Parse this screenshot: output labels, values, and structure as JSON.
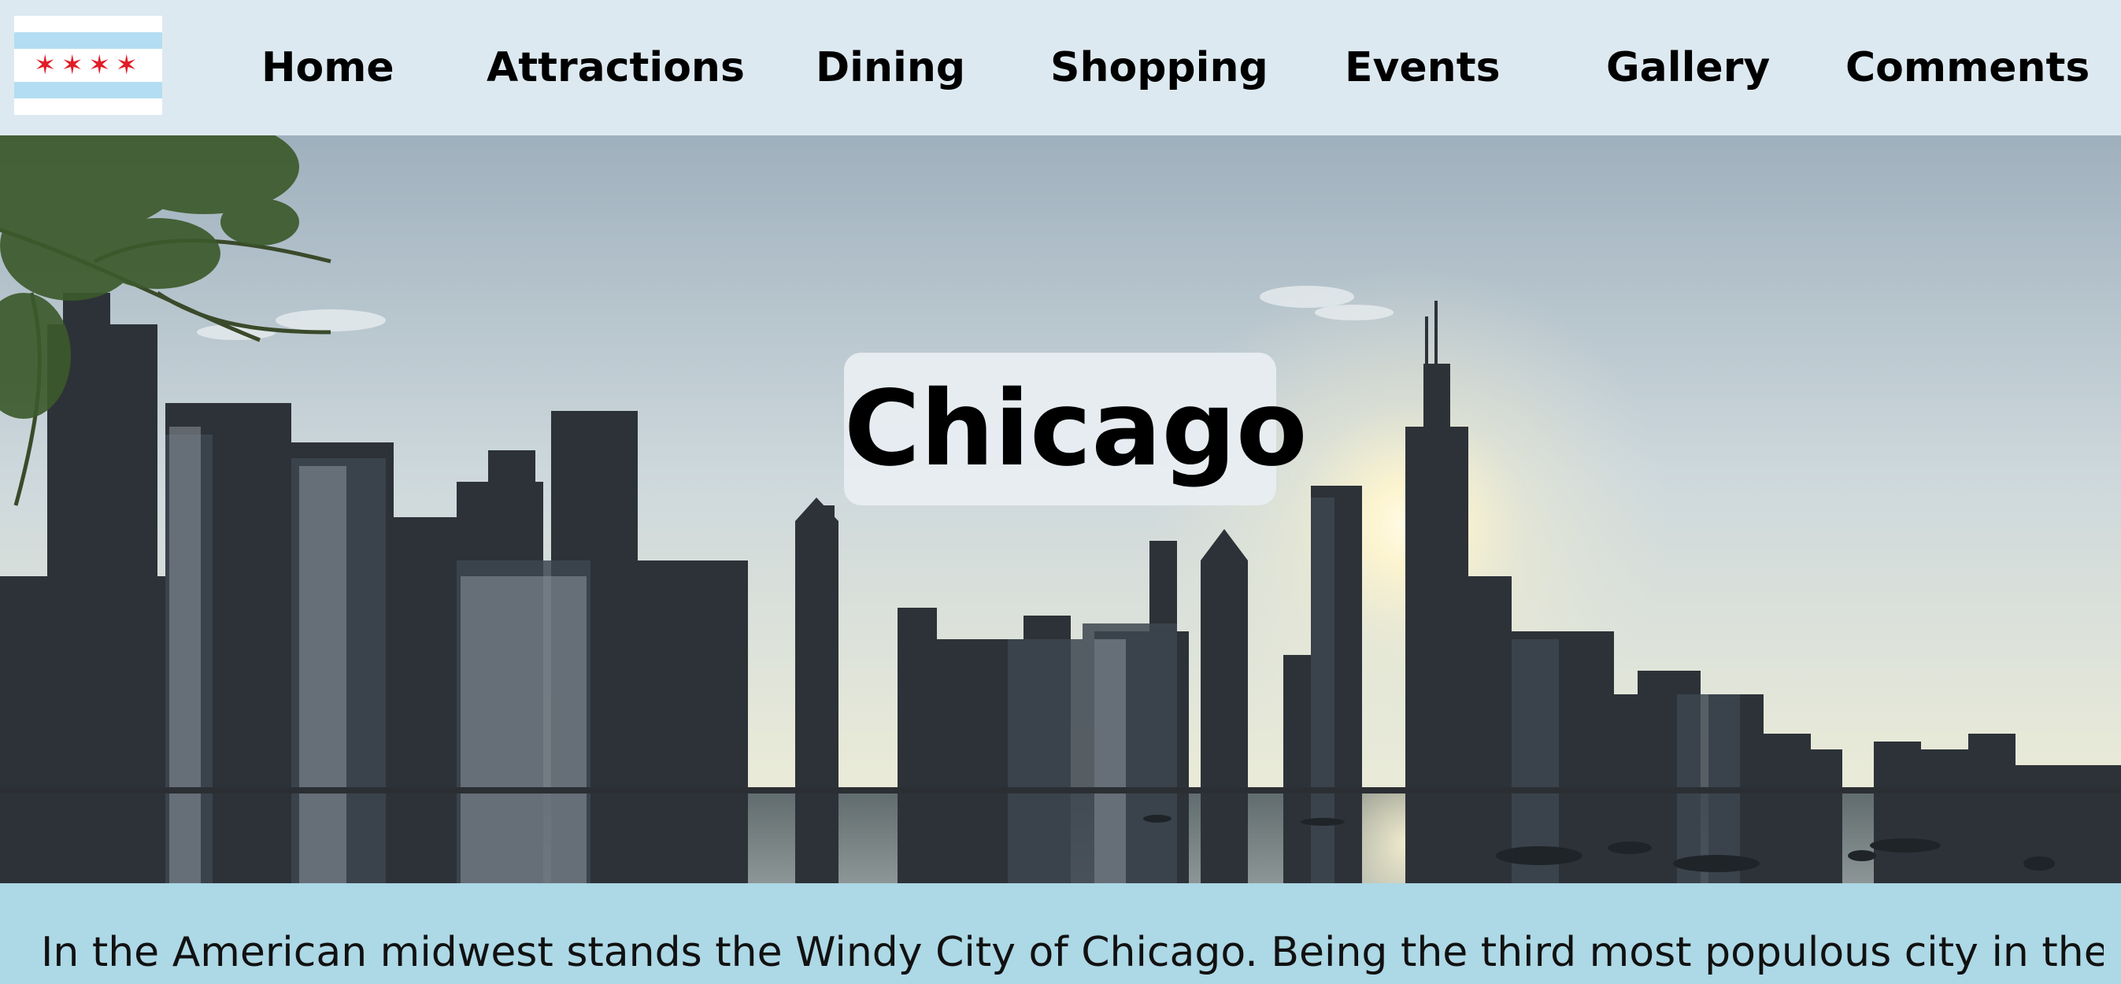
{
  "logo": {
    "icon": "chicago-flag-icon",
    "stars": "✶✶✶✶",
    "colors": {
      "stripe": "#b3ddf2",
      "star": "#e21c26"
    }
  },
  "nav": {
    "items": [
      {
        "label": "Home"
      },
      {
        "label": "Attractions"
      },
      {
        "label": "Dining"
      },
      {
        "label": "Shopping"
      },
      {
        "label": "Events"
      },
      {
        "label": "Gallery"
      },
      {
        "label": "Comments"
      }
    ]
  },
  "hero": {
    "title": "Chicago",
    "image": "chicago-skyline-image"
  },
  "content": {
    "intro": "In the American midwest stands the Windy City of Chicago. Being the third most populous city in the U.S.,"
  },
  "colors": {
    "nav_bg": "#dde9f0",
    "page_bg": "#add8e6",
    "title_box": "#e8eef2"
  }
}
